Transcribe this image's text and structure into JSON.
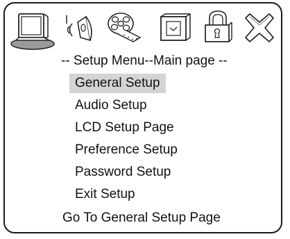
{
  "icons": [
    {
      "name": "monitor-icon",
      "selected": true
    },
    {
      "name": "speaker-icon",
      "selected": false
    },
    {
      "name": "film-reel-icon",
      "selected": false
    },
    {
      "name": "lcd-screen-icon",
      "selected": false
    },
    {
      "name": "padlock-icon",
      "selected": false
    },
    {
      "name": "exit-x-icon",
      "selected": false
    }
  ],
  "menu": {
    "title": "-- Setup Menu--Main page --",
    "items": [
      {
        "label": "General Setup",
        "selected": true
      },
      {
        "label": "Audio Setup",
        "selected": false
      },
      {
        "label": "LCD Setup Page",
        "selected": false
      },
      {
        "label": "Preference Setup",
        "selected": false
      },
      {
        "label": "Password Setup",
        "selected": false
      },
      {
        "label": "Exit Setup",
        "selected": false
      }
    ]
  },
  "status": {
    "text": "Go To General Setup Page"
  },
  "colors": {
    "highlight": "#d4d4d4",
    "selected_icon_base": "#9a9a9a",
    "text": "#111111"
  }
}
